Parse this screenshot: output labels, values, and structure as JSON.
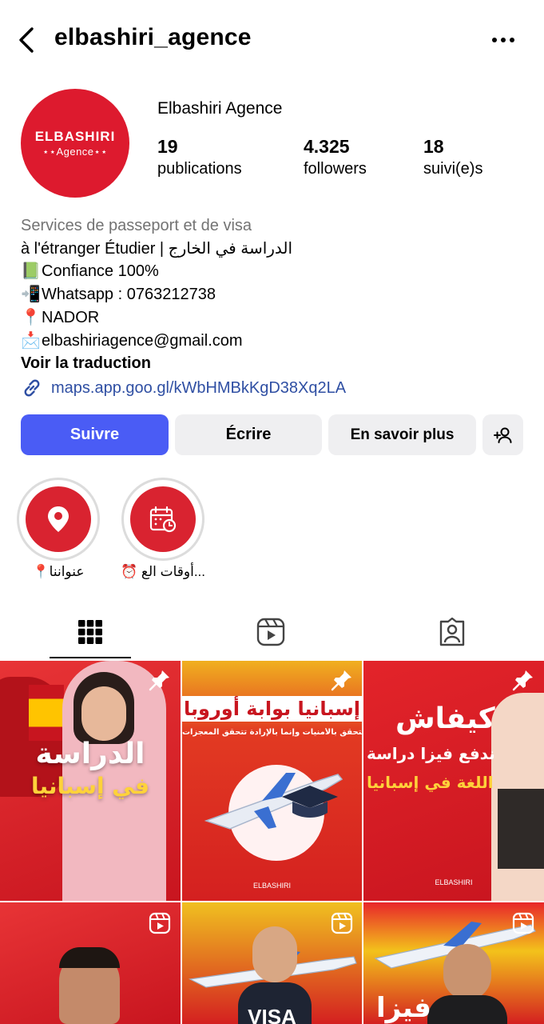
{
  "header": {
    "username": "elbashiri_agence",
    "back_icon": "chevron-left-icon",
    "more_icon": "more-horizontal-icon"
  },
  "profile": {
    "avatar_name": "ELBASHIRI",
    "avatar_sub": "⋆⋆Agence⋆⋆",
    "display_name": "Elbashiri Agence",
    "stats": [
      {
        "value": "19",
        "label": "publications"
      },
      {
        "value": "4.325",
        "label": "followers"
      },
      {
        "value": "18",
        "label": "suivi(e)s"
      }
    ]
  },
  "bio": {
    "category": "Services de passeport et de visa",
    "line1": "à l'étranger Étudier | الدراسة في الخارج",
    "line2_emoji": "📗",
    "line2": "Confiance 100%",
    "line3_emoji": "📲",
    "line3": "Whatsapp : 0763212738",
    "line4_emoji": "📍",
    "line4": "NADOR",
    "line5_emoji": "📩",
    "line5": "elbashiriagence@gmail.com",
    "translate": "Voir la traduction",
    "link": "maps.app.goo.gl/kWbHMBkKgD38Xq2LA"
  },
  "actions": {
    "follow": "Suivre",
    "write": "Écrire",
    "learn_more": "En savoir plus",
    "add_user_icon": "add-person-icon"
  },
  "highlights": [
    {
      "label": "📍عنواننا",
      "icon": "location-pin-icon"
    },
    {
      "label": "⏰ أوقات الع...",
      "icon": "calendar-clock-icon"
    }
  ],
  "tabs": [
    {
      "name": "grid",
      "icon": "grid-icon",
      "active": true
    },
    {
      "name": "reels",
      "icon": "reels-icon",
      "active": false
    },
    {
      "name": "tagged",
      "icon": "tagged-person-icon",
      "active": false
    }
  ],
  "posts": [
    {
      "title1": "الدراسة",
      "title2": "في إسبانيا",
      "badge": "pin-icon"
    },
    {
      "title1": "إسبانيا بوابة أوروبا",
      "title2": "النجاح لا يتحقق بالأمنيات وإنما بالإرادة تتحقق المعجزات",
      "footer": "ELBASHIRI",
      "badge": "pin-icon"
    },
    {
      "title1": "كيفاش",
      "title2": "ندفع فيزا دراسة",
      "title3": "اللغة في إسبانيا",
      "footer": "ELBASHIRI",
      "badge": "pin-icon"
    },
    {
      "badge": "reels-icon"
    },
    {
      "title1": "VISA",
      "badge": "reels-icon"
    },
    {
      "title1": "فيزا",
      "badge": "reels-icon"
    }
  ],
  "colors": {
    "brand_red": "#dd1a2e",
    "follow_blue": "#4a5cf5",
    "link_blue": "#2f4fa3",
    "muted_gray": "#737373",
    "button_gray": "#efeff1"
  }
}
